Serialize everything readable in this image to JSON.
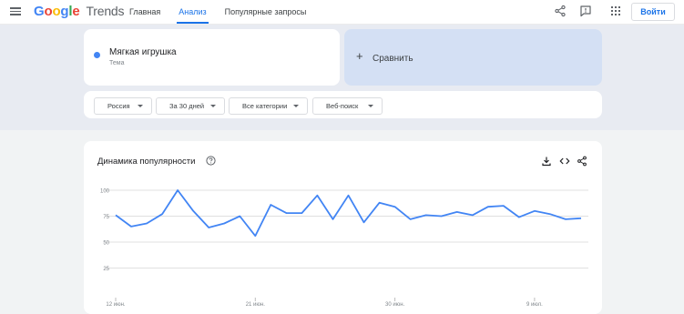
{
  "header": {
    "logo_google": "Google",
    "logo_trends": "Trends",
    "nav": [
      {
        "label": "Главная",
        "active": false
      },
      {
        "label": "Анализ",
        "active": true
      },
      {
        "label": "Популярные запросы",
        "active": false
      }
    ],
    "icons": [
      "share-icon",
      "feedback-icon",
      "apps-icon"
    ],
    "signin_label": "Войти"
  },
  "term": {
    "title": "Мягкая игрушка",
    "subtitle": "Тема",
    "color": "#4285f4"
  },
  "compare": {
    "plus": "+",
    "label": "Сравнить"
  },
  "filters": [
    {
      "label": "Россия"
    },
    {
      "label": "За 30 дней"
    },
    {
      "label": "Все категории"
    },
    {
      "label": "Веб-поиск"
    }
  ],
  "chart_section": {
    "title": "Динамика популярности",
    "actions": [
      "download-icon",
      "embed-icon",
      "share-icon"
    ]
  },
  "chart_data": {
    "type": "line",
    "title": "",
    "xlabel": "",
    "ylabel": "",
    "ylim": [
      0,
      100
    ],
    "y_ticks": [
      25,
      50,
      75,
      100
    ],
    "x_tick_labels": [
      "12 июн.",
      "21 июн.",
      "30 июн.",
      "9 июл."
    ],
    "x_tick_index": [
      0,
      9,
      18,
      27
    ],
    "grid": true,
    "series": [
      {
        "color": "#4285f4",
        "values": [
          76,
          65,
          68,
          77,
          100,
          80,
          64,
          68,
          75,
          56,
          86,
          78,
          78,
          95,
          72,
          95,
          69,
          88,
          84,
          72,
          76,
          75,
          79,
          76,
          84,
          85,
          74,
          80,
          77,
          72,
          73
        ]
      }
    ]
  }
}
